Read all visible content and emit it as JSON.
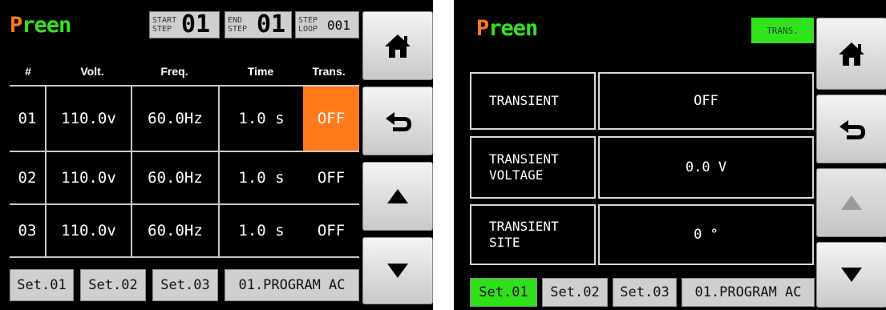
{
  "left_panel": {
    "logo": {
      "first": "P",
      "rest": "reen"
    },
    "start_step": {
      "label_top": "START",
      "label_bottom": "STEP",
      "value": "01"
    },
    "end_step": {
      "label_top": "END",
      "label_bottom": "STEP",
      "value": "01"
    },
    "step_loop": {
      "label_top": "STEP",
      "label_bottom": "LOOP",
      "value": "001"
    },
    "columns": [
      "#",
      "Volt.",
      "Freq.",
      "Time",
      "Trans."
    ],
    "rows": [
      {
        "num": "01",
        "volt": "110.0v",
        "freq": "60.0Hz",
        "time": "1.0 s",
        "trans": "OFF"
      },
      {
        "num": "02",
        "volt": "110.0v",
        "freq": "60.0Hz",
        "time": "1.0 s",
        "trans": "OFF"
      },
      {
        "num": "03",
        "volt": "110.0v",
        "freq": "60.0Hz",
        "time": "1.0 s",
        "trans": "OFF"
      }
    ],
    "set_buttons": [
      "Set.01",
      "Set.02",
      "Set.03"
    ],
    "program": "01.PROGRAM AC",
    "side_icons": [
      "home-icon",
      "back-icon",
      "up-arrow-icon",
      "down-arrow-icon"
    ]
  },
  "right_panel": {
    "logo": {
      "first": "P",
      "rest": "reen"
    },
    "badge": "TRANS.",
    "params": [
      {
        "label": "TRANSIENT",
        "value": "OFF"
      },
      {
        "label": "TRANSIENT\nVOLTAGE",
        "value": "0.0 V"
      },
      {
        "label": "TRANSIENT\nSITE",
        "value": "0 °"
      }
    ],
    "set_buttons": [
      "Set.01",
      "Set.02",
      "Set.03"
    ],
    "active_set": "Set.01",
    "program": "01.PROGRAM AC",
    "side_icons": [
      "home-icon",
      "back-icon",
      "up-arrow-icon",
      "down-arrow-icon"
    ]
  },
  "colors": {
    "orange": "#ff7a1a",
    "green": "#33e21f",
    "button_gray": "#cfcfcf"
  }
}
